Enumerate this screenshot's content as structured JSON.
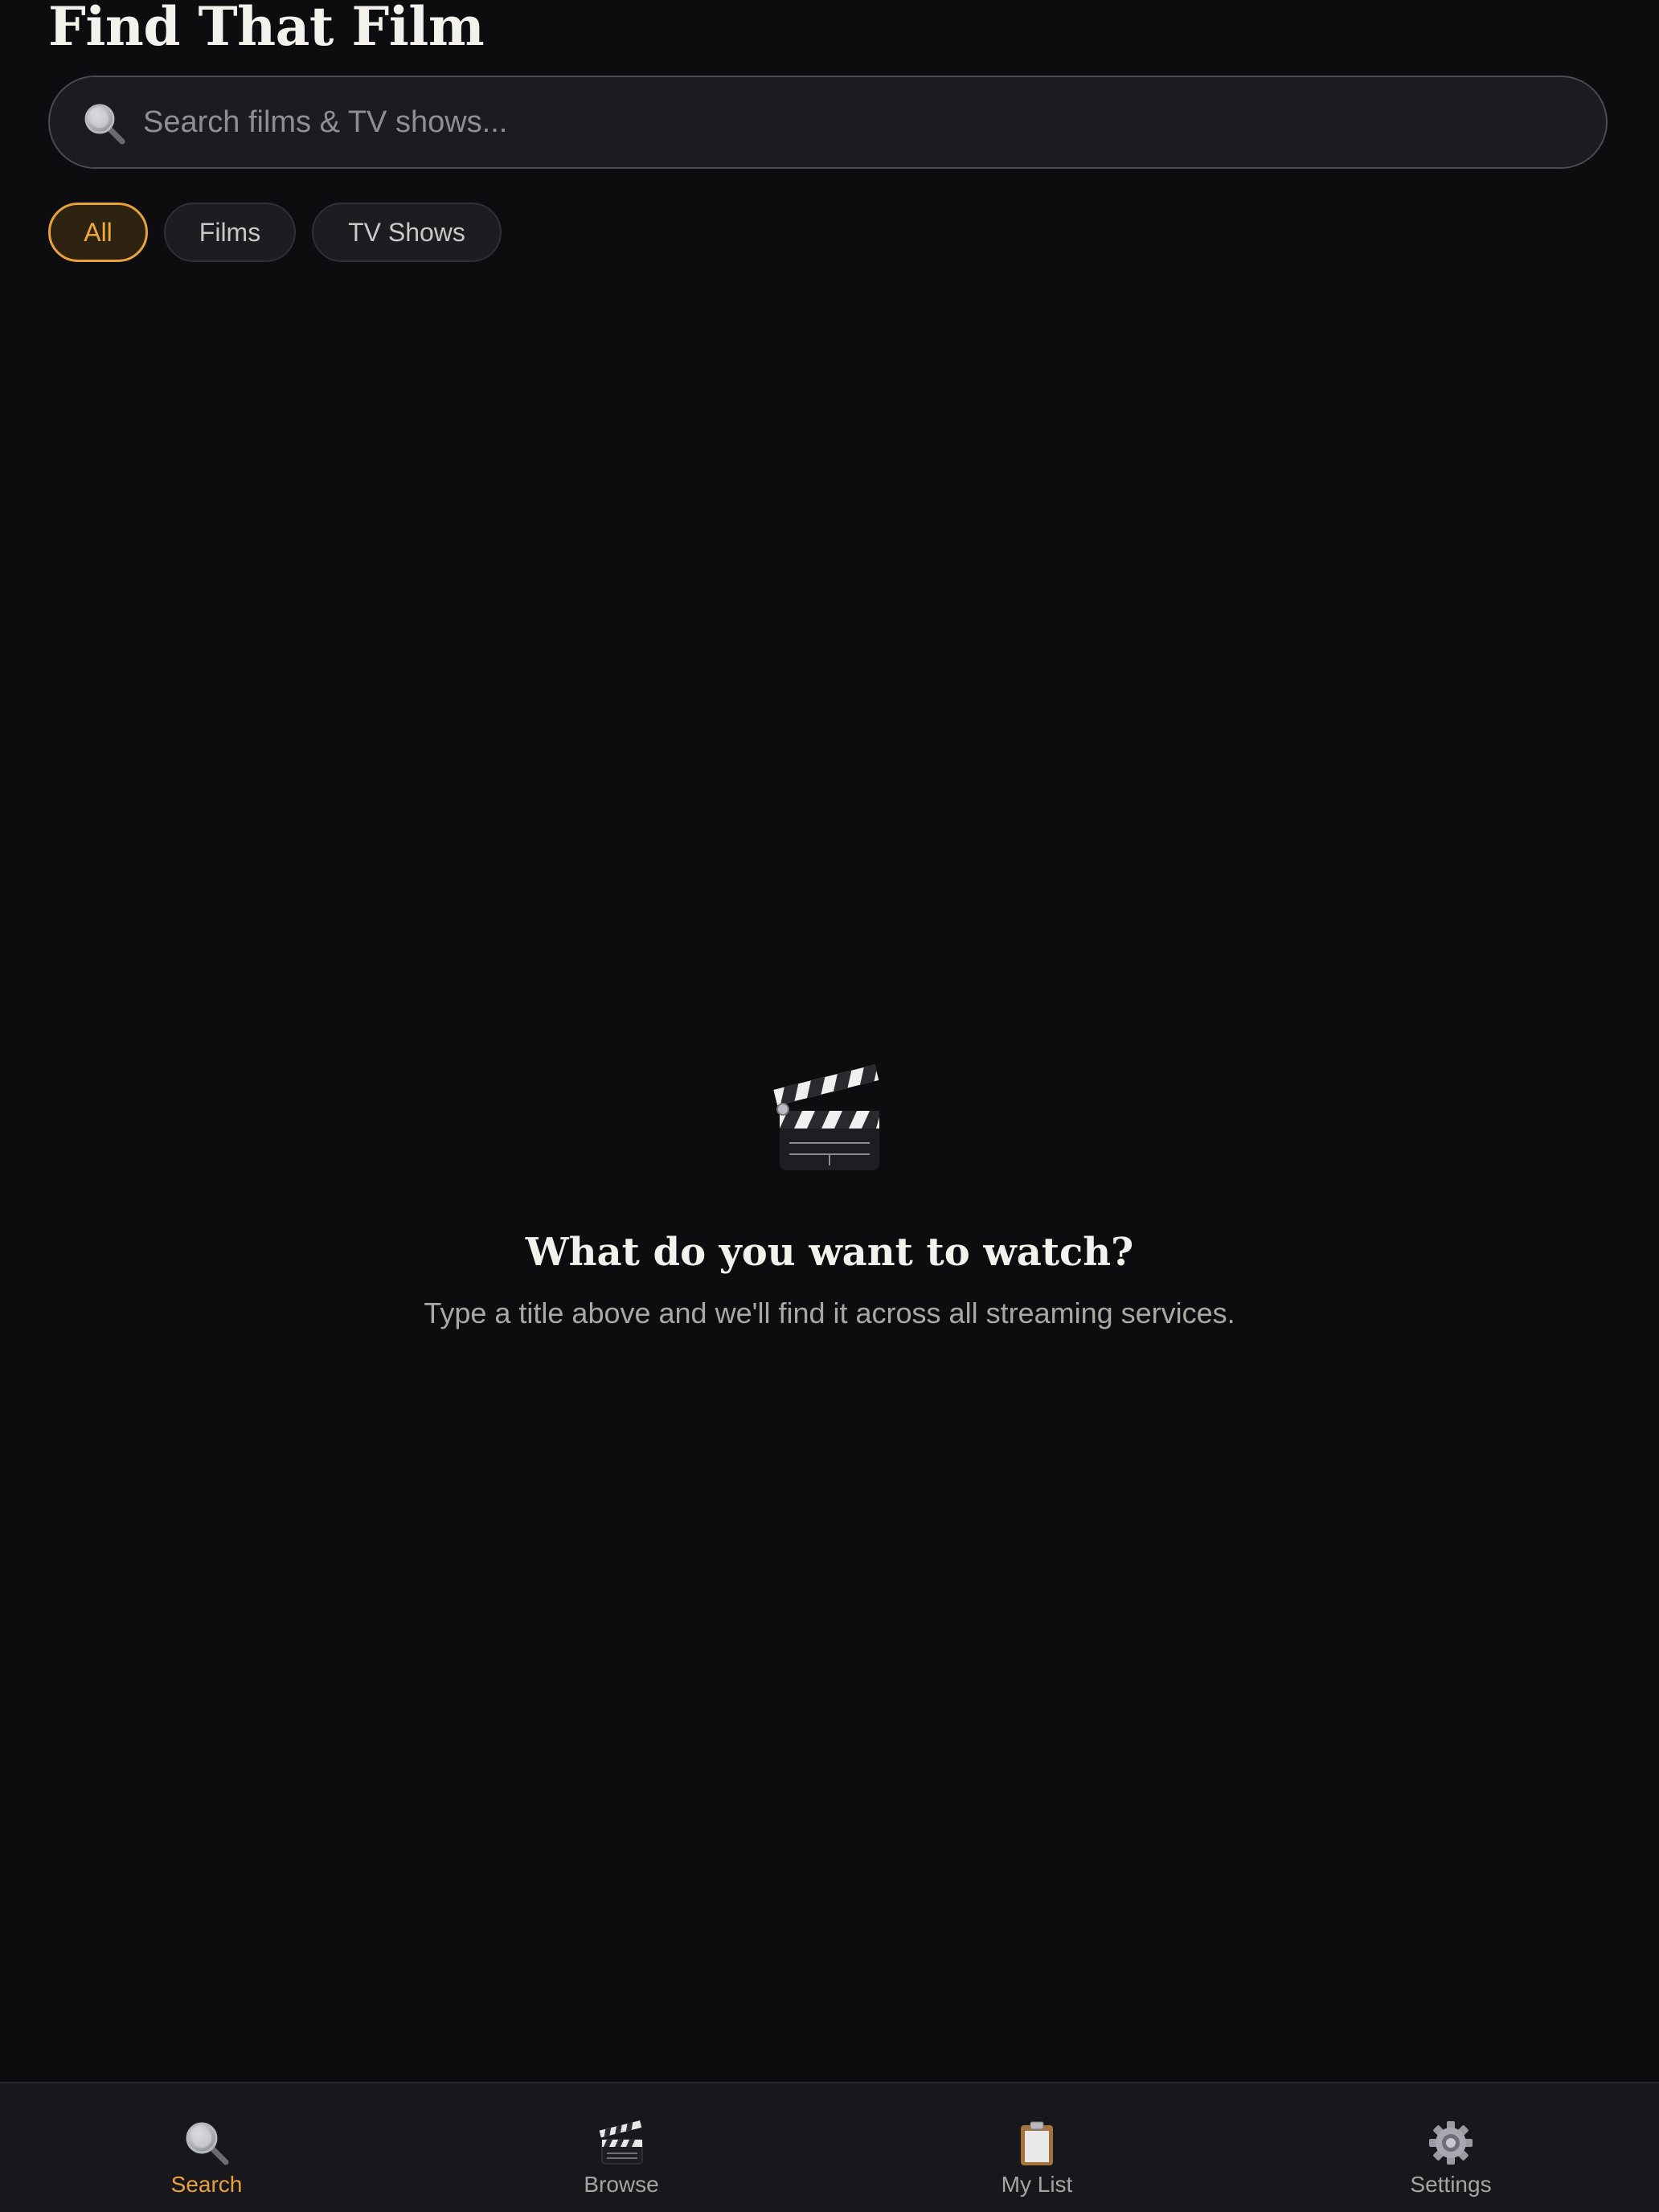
{
  "app": {
    "title": "Find That Film"
  },
  "search": {
    "placeholder": "Search films & TV shows...",
    "value": "",
    "icon": "search-icon"
  },
  "filters": {
    "selected": "All",
    "chips": [
      {
        "label": "All",
        "active": true
      },
      {
        "label": "Films",
        "active": false
      },
      {
        "label": "TV Shows",
        "active": false
      }
    ]
  },
  "empty_state": {
    "icon": "clapperboard-icon",
    "title": "What do you want to watch?",
    "subtitle": "Type a title above and we'll find it across all streaming services."
  },
  "tabbar": {
    "items": [
      {
        "label": "Search",
        "icon": "search-icon",
        "active": true
      },
      {
        "label": "Browse",
        "icon": "clapperboard-icon",
        "active": false
      },
      {
        "label": "My List",
        "icon": "clipboard-icon",
        "active": false
      },
      {
        "label": "Settings",
        "icon": "gear-icon",
        "active": false
      }
    ]
  },
  "colors": {
    "background": "#0d0d0f",
    "accent": "#e8a23b",
    "surface": "#1b1b20",
    "text_primary": "#f3f1ec",
    "text_secondary": "#a9a8a4"
  }
}
